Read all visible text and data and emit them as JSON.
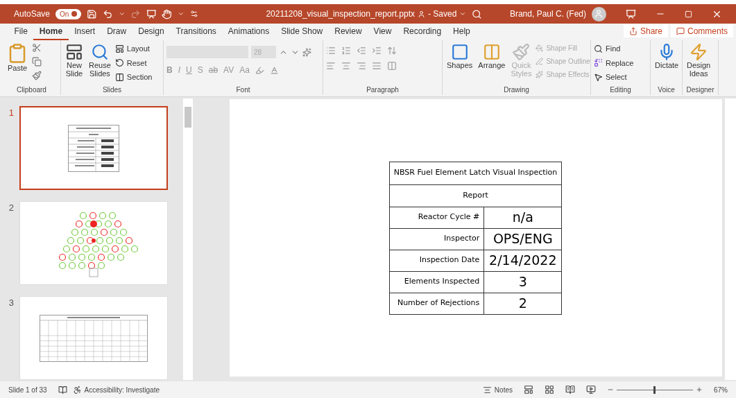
{
  "title_bar": {
    "autosave_label": "AutoSave",
    "autosave": {
      "on": true,
      "label": "On"
    },
    "filename": "20211208_visual_inspection_report.pptx",
    "saved": "- Saved",
    "user": "Brand, Paul C. (Fed)"
  },
  "menu_tabs": [
    {
      "label": "File",
      "selected": false
    },
    {
      "label": "Home",
      "selected": true
    },
    {
      "label": "Insert",
      "selected": false
    },
    {
      "label": "Draw",
      "selected": false
    },
    {
      "label": "Design",
      "selected": false
    },
    {
      "label": "Transitions",
      "selected": false
    },
    {
      "label": "Animations",
      "selected": false
    },
    {
      "label": "Slide Show",
      "selected": false
    },
    {
      "label": "Review",
      "selected": false
    },
    {
      "label": "View",
      "selected": false
    },
    {
      "label": "Recording",
      "selected": false
    },
    {
      "label": "Help",
      "selected": false
    }
  ],
  "share": "Share",
  "comments": "Comments",
  "ribbon": {
    "clipboard": {
      "label": "Clipboard",
      "paste": "Paste"
    },
    "slides": {
      "label": "Slides",
      "new_slide": [
        "New",
        "Slide"
      ],
      "reuse": [
        "Reuse",
        "Slides"
      ],
      "layout": "Layout",
      "reset": "Reset",
      "section": "Section"
    },
    "font": {
      "label": "Font",
      "size": "28",
      "buttons": [
        "B",
        "I",
        "U",
        "S",
        "ab",
        "AV",
        "Aa"
      ]
    },
    "paragraph": {
      "label": "Paragraph"
    },
    "drawing": {
      "label": "Drawing",
      "shapes": "Shapes",
      "arrange": "Arrange",
      "quick_styles": [
        "Quick",
        "Styles"
      ],
      "items": [
        {
          "label": "Shape Fill",
          "disabled": true
        },
        {
          "label": "Shape Outline",
          "disabled": true
        },
        {
          "label": "Shape Effects",
          "disabled": true
        }
      ]
    },
    "editing": {
      "label": "Editing",
      "find": "Find",
      "replace": "Replace",
      "select": "Select"
    },
    "voice": {
      "label": "Voice",
      "dictate": "Dictate"
    },
    "designer": {
      "label": "Designer",
      "design_ideas": [
        "Design",
        "Ideas"
      ]
    }
  },
  "thumbnails": [
    {
      "number": "1",
      "selected": true,
      "kind": "table"
    },
    {
      "number": "2",
      "selected": false,
      "kind": "diagram"
    },
    {
      "number": "3",
      "selected": false,
      "kind": "grid"
    }
  ],
  "slide": {
    "title": "NBSR Fuel Element Latch Visual Inspection",
    "subtitle": "Report",
    "rows": [
      {
        "label": "Reactor Cycle #",
        "value": "n/a"
      },
      {
        "label": "Inspector",
        "value": "OPS/ENG"
      },
      {
        "label": "Inspection Date",
        "value": "2/14/2022"
      },
      {
        "label": "Elements Inspected",
        "value": "3"
      },
      {
        "label": "Number of Rejections",
        "value": "2"
      }
    ]
  },
  "status_bar": {
    "slide_counter": "Slide 1 of 33",
    "accessibility": "Accessibility: Investigate",
    "notes": "Notes",
    "zoom": "67%",
    "zoom_slider": {
      "level": 0.5
    }
  }
}
